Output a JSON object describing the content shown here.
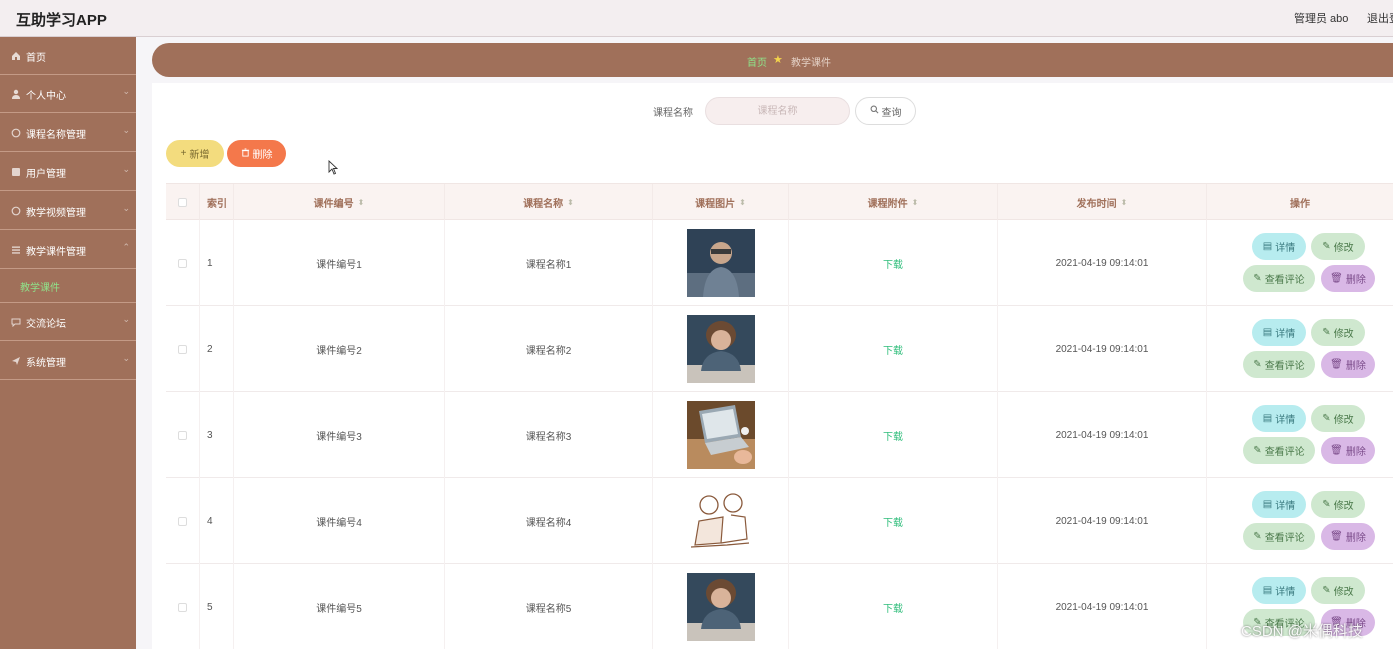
{
  "app": {
    "title": "互助学习APP"
  },
  "header": {
    "admin_label": "管理员 abo",
    "logout_label": "退出登录"
  },
  "sidebar": {
    "items": [
      {
        "label": "首页",
        "icon": "home-icon"
      },
      {
        "label": "个人中心",
        "icon": "user-icon"
      },
      {
        "label": "课程名称管理",
        "icon": "circle-icon"
      },
      {
        "label": "用户管理",
        "icon": "grid-icon"
      },
      {
        "label": "教学视频管理",
        "icon": "circle-icon"
      },
      {
        "label": "教学课件管理",
        "icon": "list-icon"
      },
      {
        "label": "交流论坛",
        "icon": "chat-icon"
      },
      {
        "label": "系统管理",
        "icon": "send-icon"
      }
    ],
    "sub_item": "教学课件"
  },
  "breadcrumb": {
    "home": "首页",
    "current": "教学课件"
  },
  "search": {
    "label": "课程名称",
    "placeholder": "课程名称",
    "button": "查询"
  },
  "toolbar": {
    "add": "新增",
    "delete": "删除"
  },
  "table": {
    "headers": [
      "索引",
      "课件编号",
      "课程名称",
      "课程图片",
      "课程附件",
      "发布时间",
      "操作"
    ],
    "rows": [
      {
        "index": "1",
        "code": "课件编号1",
        "name": "课程名称1",
        "attachment": "下载",
        "time": "2021-04-19 09:14:01"
      },
      {
        "index": "2",
        "code": "课件编号2",
        "name": "课程名称2",
        "attachment": "下载",
        "time": "2021-04-19 09:14:01"
      },
      {
        "index": "3",
        "code": "课件编号3",
        "name": "课程名称3",
        "attachment": "下载",
        "time": "2021-04-19 09:14:01"
      },
      {
        "index": "4",
        "code": "课件编号4",
        "name": "课程名称4",
        "attachment": "下载",
        "time": "2021-04-19 09:14:01"
      },
      {
        "index": "5",
        "code": "课件编号5",
        "name": "课程名称5",
        "attachment": "下载",
        "time": "2021-04-19 09:14:01"
      }
    ],
    "actions": {
      "detail": "详情",
      "edit": "修改",
      "comment": "查看评论",
      "delete": "删除"
    }
  },
  "watermark": "CSDN @米偶科技",
  "colors": {
    "sidebar": "#a0705a",
    "accent_green": "#8fe38a",
    "download": "#2ebd7a",
    "delete_button": "#f4784b",
    "add_button": "#f3dc7e"
  }
}
